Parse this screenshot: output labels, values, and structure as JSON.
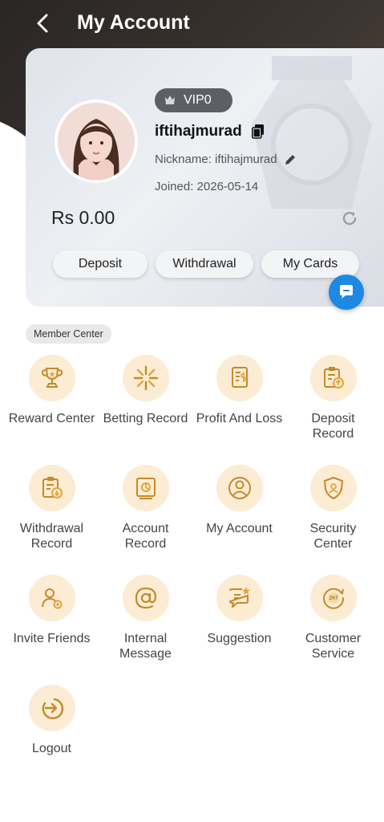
{
  "header": {
    "title": "My Account"
  },
  "profile": {
    "vip": "VIP0",
    "username": "iftihajmurad",
    "nickname": "Nickname: iftihajmurad",
    "joined_label": "Joined:",
    "joined_date": "2026-05-14",
    "balance": "Rs 0.00"
  },
  "actions": {
    "deposit": "Deposit",
    "withdrawal": "Withdrawal",
    "my_cards": "My Cards"
  },
  "member_center": {
    "title": "Member Center",
    "items": [
      {
        "label": "Reward Center",
        "icon": "trophy-icon"
      },
      {
        "label": "Betting Record",
        "icon": "sparkle-icon"
      },
      {
        "label": "Profit And Loss",
        "icon": "ledger-icon"
      },
      {
        "label": "Deposit Record",
        "icon": "deposit-clipboard-icon"
      },
      {
        "label": "Withdrawal Record",
        "icon": "withdrawal-clipboard-icon"
      },
      {
        "label": "Account Record",
        "icon": "account-chart-icon"
      },
      {
        "label": "My Account",
        "icon": "user-circle-icon"
      },
      {
        "label": "Security Center",
        "icon": "shield-icon"
      },
      {
        "label": "Invite Friends",
        "icon": "invite-user-icon"
      },
      {
        "label": "Internal Message",
        "icon": "at-sign-icon"
      },
      {
        "label": "Suggestion",
        "icon": "suggestion-icon"
      },
      {
        "label": "Customer Service",
        "icon": "service-24-7-icon"
      },
      {
        "label": "Logout",
        "icon": "logout-icon"
      }
    ]
  },
  "colors": {
    "accent": "#e2a53a",
    "icon_bg": "#fbecd3",
    "fab": "#1e88e5"
  }
}
